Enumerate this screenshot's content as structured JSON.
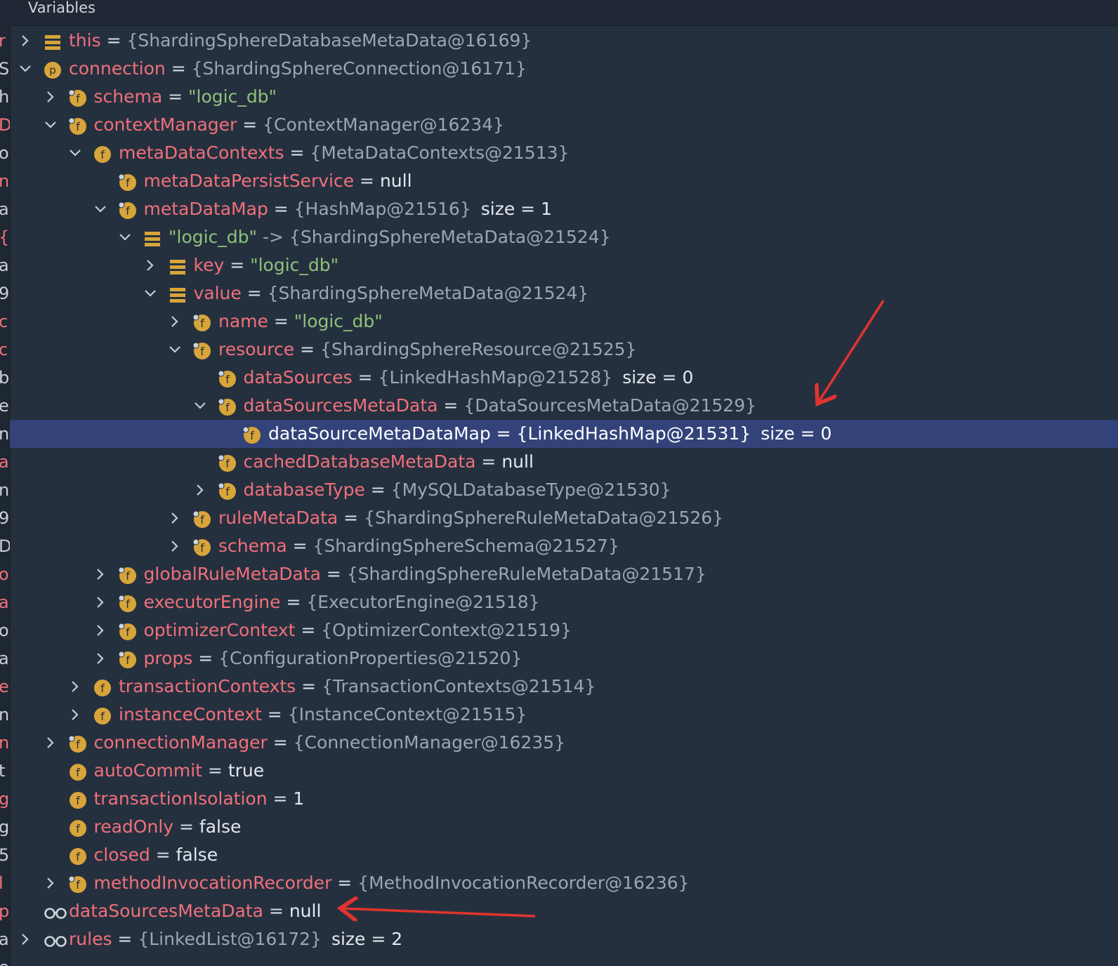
{
  "header": {
    "title": "Variables"
  },
  "gutter_chars": [
    "r",
    "S",
    "h",
    "D",
    "o",
    "n",
    "a",
    "{",
    "a",
    "9",
    "c",
    "c",
    "b",
    "e",
    "n",
    "a",
    "n",
    "9",
    "D",
    "o",
    "a",
    "o",
    "a",
    "e",
    "n",
    "n",
    "t",
    "g",
    "g",
    "5",
    "l",
    "p",
    "a",
    "e"
  ],
  "colors": {
    "background": "#25303f",
    "field_name": "#f0707a",
    "string_value": "#8fc27a",
    "reference_value": "#9aa6b4",
    "selection": "#33437a",
    "annotation_arrow": "#e0342e",
    "field_icon": "#d8a53a"
  },
  "rows": [
    {
      "depth": 0,
      "expander": "collapsed",
      "icon": "list-icon",
      "name": "this",
      "eq": " = ",
      "value": "{ShardingSphereDatabaseMetaData@16169}",
      "kind": "ref",
      "extra": ""
    },
    {
      "depth": 0,
      "expander": "expanded",
      "icon": "param-icon",
      "name": "connection",
      "eq": " = ",
      "value": "{ShardingSphereConnection@16171}",
      "kind": "ref",
      "extra": ""
    },
    {
      "depth": 1,
      "expander": "collapsed",
      "icon": "field-lock-icon",
      "name": "schema",
      "eq": " = ",
      "value": "\"logic_db\"",
      "kind": "str",
      "extra": ""
    },
    {
      "depth": 1,
      "expander": "expanded",
      "icon": "field-lock-icon",
      "name": "contextManager",
      "eq": " = ",
      "value": "{ContextManager@16234}",
      "kind": "ref",
      "extra": ""
    },
    {
      "depth": 2,
      "expander": "expanded",
      "icon": "field-icon",
      "name": "metaDataContexts",
      "eq": " = ",
      "value": "{MetaDataContexts@21513}",
      "kind": "ref",
      "extra": ""
    },
    {
      "depth": 3,
      "expander": "none",
      "icon": "field-lock-icon",
      "name": "metaDataPersistService",
      "eq": " = ",
      "value": "null",
      "kind": "lit",
      "extra": ""
    },
    {
      "depth": 3,
      "expander": "expanded",
      "icon": "field-lock-icon",
      "name": "metaDataMap",
      "eq": " = ",
      "value": "{HashMap@21516}",
      "kind": "ref",
      "extra": "size = 1"
    },
    {
      "depth": 4,
      "expander": "expanded",
      "icon": "list-icon",
      "name": "\"logic_db\"",
      "eq": " -> ",
      "value": "{ShardingSphereMetaData@21524}",
      "kind": "ref",
      "extra": "",
      "name_kind": "str"
    },
    {
      "depth": 5,
      "expander": "collapsed",
      "icon": "list-icon",
      "name": "key",
      "eq": " = ",
      "value": "\"logic_db\"",
      "kind": "str",
      "extra": ""
    },
    {
      "depth": 5,
      "expander": "expanded",
      "icon": "list-icon",
      "name": "value",
      "eq": " = ",
      "value": "{ShardingSphereMetaData@21524}",
      "kind": "ref",
      "extra": ""
    },
    {
      "depth": 6,
      "expander": "collapsed",
      "icon": "field-lock-icon",
      "name": "name",
      "eq": " = ",
      "value": "\"logic_db\"",
      "kind": "str",
      "extra": ""
    },
    {
      "depth": 6,
      "expander": "expanded",
      "icon": "field-lock-icon",
      "name": "resource",
      "eq": " = ",
      "value": "{ShardingSphereResource@21525}",
      "kind": "ref",
      "extra": ""
    },
    {
      "depth": 7,
      "expander": "none",
      "icon": "field-lock-icon",
      "name": "dataSources",
      "eq": " = ",
      "value": "{LinkedHashMap@21528}",
      "kind": "ref",
      "extra": "size = 0"
    },
    {
      "depth": 7,
      "expander": "expanded",
      "icon": "field-lock-icon",
      "name": "dataSourcesMetaData",
      "eq": " = ",
      "value": "{DataSourcesMetaData@21529}",
      "kind": "ref",
      "extra": ""
    },
    {
      "depth": 8,
      "expander": "none",
      "icon": "field-lock-icon",
      "name": "dataSourceMetaDataMap",
      "eq": " = ",
      "value": "{LinkedHashMap@21531}",
      "kind": "ref",
      "extra": "size = 0",
      "selected": true
    },
    {
      "depth": 7,
      "expander": "none",
      "icon": "field-lock-icon",
      "name": "cachedDatabaseMetaData",
      "eq": " = ",
      "value": "null",
      "kind": "lit",
      "extra": ""
    },
    {
      "depth": 7,
      "expander": "collapsed",
      "icon": "field-lock-icon",
      "name": "databaseType",
      "eq": " = ",
      "value": "{MySQLDatabaseType@21530}",
      "kind": "ref",
      "extra": ""
    },
    {
      "depth": 6,
      "expander": "collapsed",
      "icon": "field-lock-icon",
      "name": "ruleMetaData",
      "eq": " = ",
      "value": "{ShardingSphereRuleMetaData@21526}",
      "kind": "ref",
      "extra": ""
    },
    {
      "depth": 6,
      "expander": "collapsed",
      "icon": "field-lock-icon",
      "name": "schema",
      "eq": " = ",
      "value": "{ShardingSphereSchema@21527}",
      "kind": "ref",
      "extra": ""
    },
    {
      "depth": 3,
      "expander": "collapsed",
      "icon": "field-lock-icon",
      "name": "globalRuleMetaData",
      "eq": " = ",
      "value": "{ShardingSphereRuleMetaData@21517}",
      "kind": "ref",
      "extra": ""
    },
    {
      "depth": 3,
      "expander": "collapsed",
      "icon": "field-lock-icon",
      "name": "executorEngine",
      "eq": " = ",
      "value": "{ExecutorEngine@21518}",
      "kind": "ref",
      "extra": ""
    },
    {
      "depth": 3,
      "expander": "collapsed",
      "icon": "field-lock-icon",
      "name": "optimizerContext",
      "eq": " = ",
      "value": "{OptimizerContext@21519}",
      "kind": "ref",
      "extra": ""
    },
    {
      "depth": 3,
      "expander": "collapsed",
      "icon": "field-lock-icon",
      "name": "props",
      "eq": " = ",
      "value": "{ConfigurationProperties@21520}",
      "kind": "ref",
      "extra": ""
    },
    {
      "depth": 2,
      "expander": "collapsed",
      "icon": "field-icon",
      "name": "transactionContexts",
      "eq": " = ",
      "value": "{TransactionContexts@21514}",
      "kind": "ref",
      "extra": ""
    },
    {
      "depth": 2,
      "expander": "collapsed",
      "icon": "field-icon",
      "name": "instanceContext",
      "eq": " = ",
      "value": "{InstanceContext@21515}",
      "kind": "ref",
      "extra": ""
    },
    {
      "depth": 1,
      "expander": "collapsed",
      "icon": "field-lock-icon",
      "name": "connectionManager",
      "eq": " = ",
      "value": "{ConnectionManager@16235}",
      "kind": "ref",
      "extra": ""
    },
    {
      "depth": 1,
      "expander": "none",
      "icon": "field-icon",
      "name": "autoCommit",
      "eq": " = ",
      "value": "true",
      "kind": "lit",
      "extra": ""
    },
    {
      "depth": 1,
      "expander": "none",
      "icon": "field-icon",
      "name": "transactionIsolation",
      "eq": " = ",
      "value": "1",
      "kind": "lit",
      "extra": ""
    },
    {
      "depth": 1,
      "expander": "none",
      "icon": "field-icon",
      "name": "readOnly",
      "eq": " = ",
      "value": "false",
      "kind": "lit",
      "extra": ""
    },
    {
      "depth": 1,
      "expander": "none",
      "icon": "field-icon",
      "name": "closed",
      "eq": " = ",
      "value": "false",
      "kind": "lit",
      "extra": ""
    },
    {
      "depth": 1,
      "expander": "collapsed",
      "icon": "field-lock-icon",
      "name": "methodInvocationRecorder",
      "eq": " = ",
      "value": "{MethodInvocationRecorder@16236}",
      "kind": "ref",
      "extra": ""
    },
    {
      "depth": 0,
      "expander": "none",
      "icon": "watch-icon",
      "name": "dataSourcesMetaData",
      "eq": " = ",
      "value": "null",
      "kind": "lit",
      "extra": ""
    },
    {
      "depth": 0,
      "expander": "collapsed",
      "icon": "watch-icon",
      "name": "rules",
      "eq": " = ",
      "value": "{LinkedList@16172}",
      "kind": "ref",
      "extra": "size = 2"
    }
  ]
}
